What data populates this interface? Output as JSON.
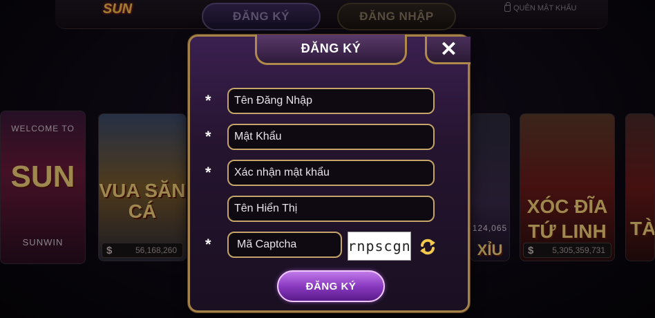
{
  "header": {
    "logo_text": "SUN",
    "tab_register": "ĐĂNG KÝ",
    "tab_login": "ĐĂNG NHẬP",
    "forgot_password": "QUÊN MẬT KHẨU"
  },
  "games": {
    "sunwin": {
      "welcome": "WELCOME TO",
      "title": "SUN",
      "subtitle": "SUNWIN"
    },
    "vua": {
      "title": "VUA SĂN CÁ",
      "jackpot": "56,168,260"
    },
    "taixiu": {
      "title": "XỈU",
      "jackpot": "124,065"
    },
    "xocdia": {
      "title": "XÓC ĐĨA TỨ LINH",
      "jackpot": "5,305,359,731"
    },
    "right": {
      "title": "TÀ"
    }
  },
  "modal": {
    "title": "ĐĂNG KÝ",
    "close_label": "✕",
    "required_mark": "*",
    "fields": {
      "username": "Tên Đăng Nhập",
      "password": "Mật Khẩu",
      "confirm_password": "Xác nhận mật khẩu",
      "display_name": "Tên Hiển Thị",
      "captcha": "Mã Captcha"
    },
    "captcha_code": "rnpscgn",
    "submit_label": "ĐĂNG KÝ"
  },
  "colors": {
    "accent_gold": "#c5a56a",
    "modal_bg": "#25142f",
    "submit_purple": "#8a3ac0"
  }
}
